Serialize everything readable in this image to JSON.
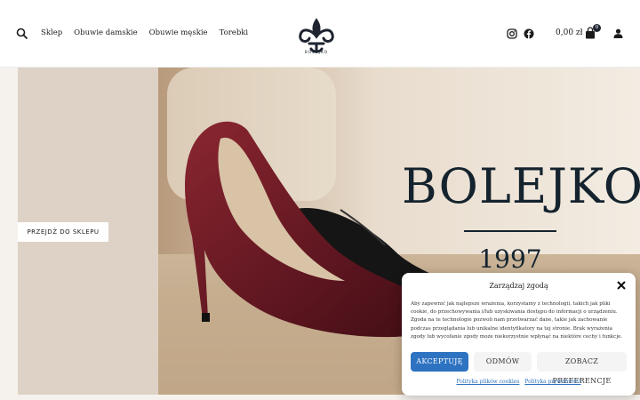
{
  "header": {
    "nav": [
      "Sklep",
      "Obuwie damskie",
      "Obuwie męskie",
      "Torebki"
    ],
    "logo_text": "BOLEJKO",
    "cart_total": "0,00 zł",
    "cart_count": "0",
    "icons": [
      "search-icon",
      "instagram-icon",
      "facebook-icon",
      "bag-icon",
      "user-icon"
    ]
  },
  "hero": {
    "cta_label": "PRZEJDŹ DO SKLEPU",
    "brand": "BOLEJKO",
    "year": "1997"
  },
  "consent": {
    "title": "Zarządzaj zgodą",
    "text": "Aby zapewnić jak najlepsze wrażenia, korzystamy z technologii, takich jak pliki cookie, do przechowywania i/lub uzyskiwania dostępu do informacji o urządzeniu. Zgoda na te technologie pozwoli nam przetwarzać dane, takie jak zachowanie podczas przeglądania lub unikalne identyfikatory na tej stronie. Brak wyrażenia zgody lub wycofanie zgody może niekorzystnie wpłynąć na niektóre cechy i funkcje.",
    "accept": "AKCEPTUJĘ",
    "deny": "ODMÓW",
    "prefs": "ZOBACZ PREFERENCJE",
    "link_cookies": "Polityka plików cookies",
    "link_privacy": "Polityka prywatności"
  },
  "colors": {
    "accent": "#2e73c1",
    "navy": "#14232e",
    "shoe_burgundy": "#6b1a22",
    "panel_beige": "#ddd2c5"
  }
}
